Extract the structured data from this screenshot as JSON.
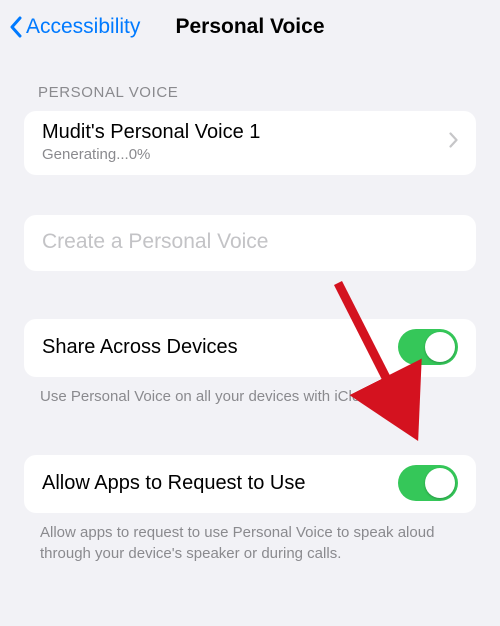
{
  "nav": {
    "back_label": "Accessibility",
    "title": "Personal Voice"
  },
  "sections": {
    "voices": {
      "header": "PERSONAL VOICE",
      "item": {
        "title": "Mudit's Personal Voice 1",
        "subtitle": "Generating...0%"
      }
    },
    "create": {
      "label": "Create a Personal Voice"
    },
    "share": {
      "label": "Share Across Devices",
      "toggle": true,
      "footer": "Use Personal Voice on all your devices with iCloud."
    },
    "allow": {
      "label": "Allow Apps to Request to Use",
      "toggle": true,
      "footer": "Allow apps to request to use Personal Voice to speak aloud through your device's speaker or during calls."
    }
  },
  "colors": {
    "accent": "#007aff",
    "toggle_on": "#35c759",
    "annotation": "#d4121f"
  },
  "annotation": {
    "type": "arrow",
    "target": "allow-apps-toggle"
  }
}
